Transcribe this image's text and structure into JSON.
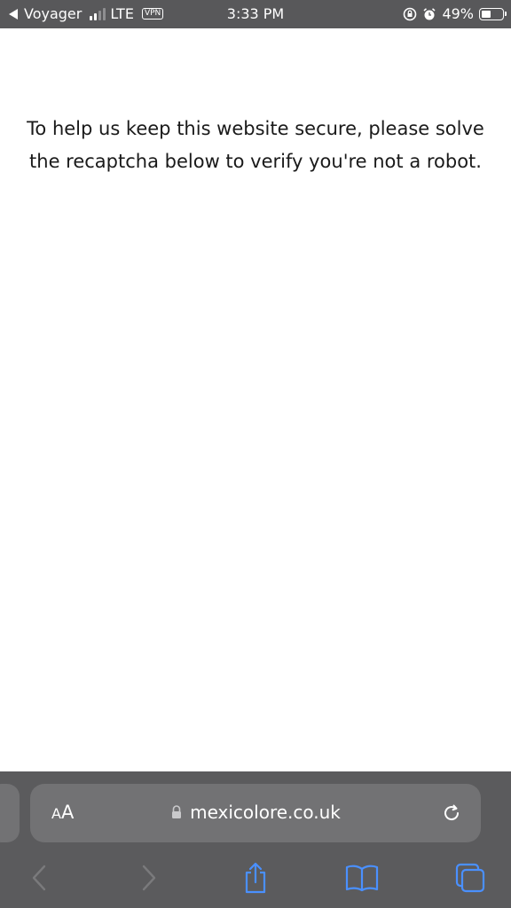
{
  "status_bar": {
    "back_app": "Voyager",
    "network": "LTE",
    "vpn": "VPN",
    "time": "3:33 PM",
    "battery_percent_text": "49%",
    "battery_level": 0.49,
    "icons": [
      "back-arrow-icon",
      "signal-icon",
      "orientation-lock-icon",
      "alarm-icon",
      "battery-icon"
    ]
  },
  "page": {
    "message": "To help us keep this website secure, please solve the recaptcha below to verify you're not a robot."
  },
  "address_bar": {
    "aa_small": "A",
    "aa_large": "A",
    "url": "mexicolore.co.uk",
    "icons": [
      "lock-icon",
      "reload-icon"
    ]
  },
  "toolbar": {
    "icons": [
      "back-icon",
      "forward-icon",
      "share-icon",
      "bookmarks-icon",
      "tabs-icon"
    ],
    "active_color": "#4a90ff",
    "disabled_color": "#7a7a7c"
  }
}
